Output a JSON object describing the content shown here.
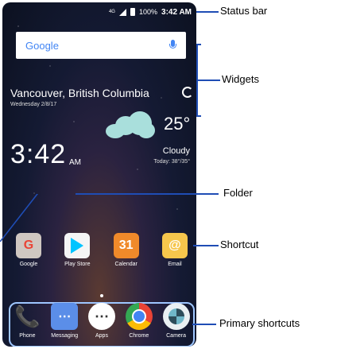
{
  "status_bar": {
    "network": "4G",
    "battery": "100%",
    "time": "3:42 AM"
  },
  "search": {
    "logo": "Google"
  },
  "weather": {
    "location": "Vancouver, British Columbia",
    "date": "Wednesday 2/8/17",
    "temperature": "25°",
    "clock_time": "3:42",
    "clock_ampm": "AM",
    "condition": "Cloudy",
    "today_range": "Today: 38°/35°"
  },
  "apps_row": [
    {
      "label": "Google",
      "glyph": "G"
    },
    {
      "label": "Play Store",
      "glyph": ""
    },
    {
      "label": "Calendar",
      "glyph": "31"
    },
    {
      "label": "Email",
      "glyph": "@"
    }
  ],
  "dock": [
    {
      "label": "Phone",
      "glyph": "📞"
    },
    {
      "label": "Messaging",
      "glyph": "⋯"
    },
    {
      "label": "Apps",
      "glyph": "⋯"
    },
    {
      "label": "Chrome",
      "glyph": ""
    },
    {
      "label": "Camera",
      "glyph": ""
    }
  ],
  "annotations": {
    "status_bar": "Status  bar",
    "widgets": "Widgets",
    "folder": "Folder",
    "shortcut": "Shortcut",
    "primary_shortcuts": "Primary shortcuts"
  },
  "colors": {
    "annotation_line": "#1f4db5"
  }
}
